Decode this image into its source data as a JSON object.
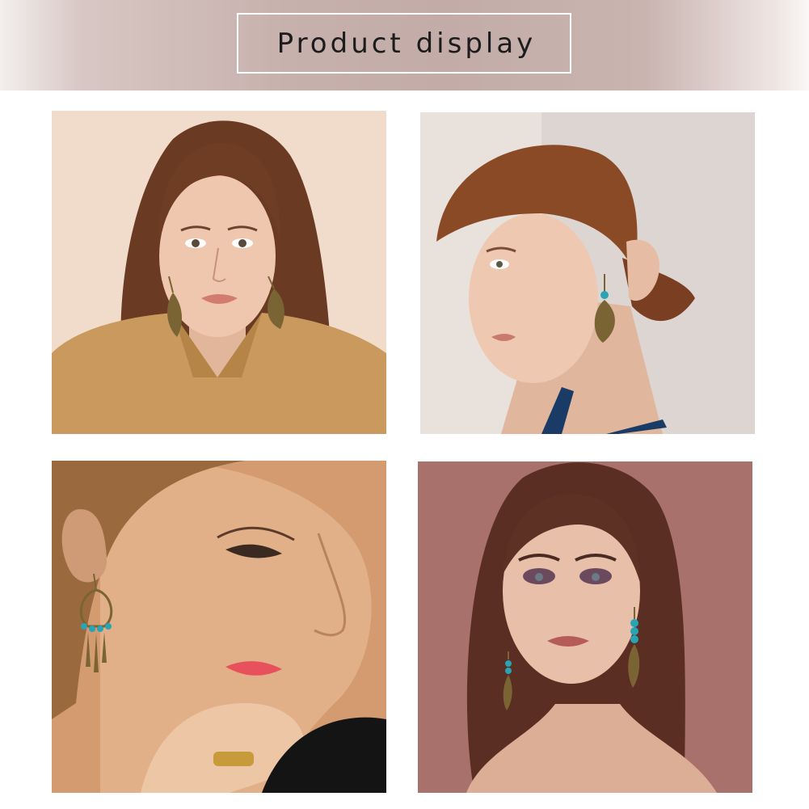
{
  "header": {
    "title": "Product display"
  },
  "photos": [
    {
      "subject": "woman-with-leaf-drop-earrings-front"
    },
    {
      "subject": "woman-with-leaf-earring-side-view"
    },
    {
      "subject": "woman-with-dreamcatcher-earring-profile"
    },
    {
      "subject": "woman-with-beaded-feather-earrings"
    }
  ],
  "colors": {
    "banner": "#c6b0ac",
    "earring_bronze": "#7a6434",
    "bead_turquoise": "#2aa3b5"
  }
}
